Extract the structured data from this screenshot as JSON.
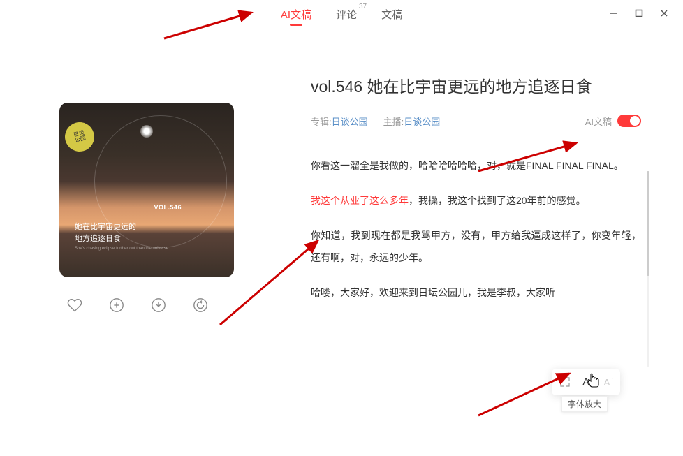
{
  "tabs": {
    "ai_transcript": "AI文稿",
    "comments": "评论",
    "comments_count": "37",
    "transcript": "文稿"
  },
  "cover": {
    "badge_line1": "日谈",
    "badge_line2": "公园",
    "vol": "VOL.546",
    "title_line1": "她在比宇宙更远的",
    "title_line2": "地方追逐日食",
    "subtitle": "She's chasing eclipse further out than the universe"
  },
  "episode": {
    "title": "vol.546 她在比宇宙更远的地方追逐日食",
    "album_label": "专辑:",
    "album_name": "日谈公园",
    "host_label": "主播:",
    "host_name": "日谈公园",
    "ai_toggle_label": "AI文稿"
  },
  "transcript": {
    "p1": "你看这一溜全是我做的，哈哈哈哈哈哈，对，就是FINAL FINAL FINAL。",
    "p2_highlight": "我这个从业了这么多年",
    "p2_rest": "，我操，我这个找到了这20年前的感觉。",
    "p3": "你知道，我到现在都是我骂甲方，没有，甲方给我逼成这样了，你变年轻，还有啊，对，永远的少年。",
    "p4": "哈喽，大家好，欢迎来到日坛公园儿，我是李叔，大家听"
  },
  "font_controls": {
    "tooltip": "字体放大"
  }
}
